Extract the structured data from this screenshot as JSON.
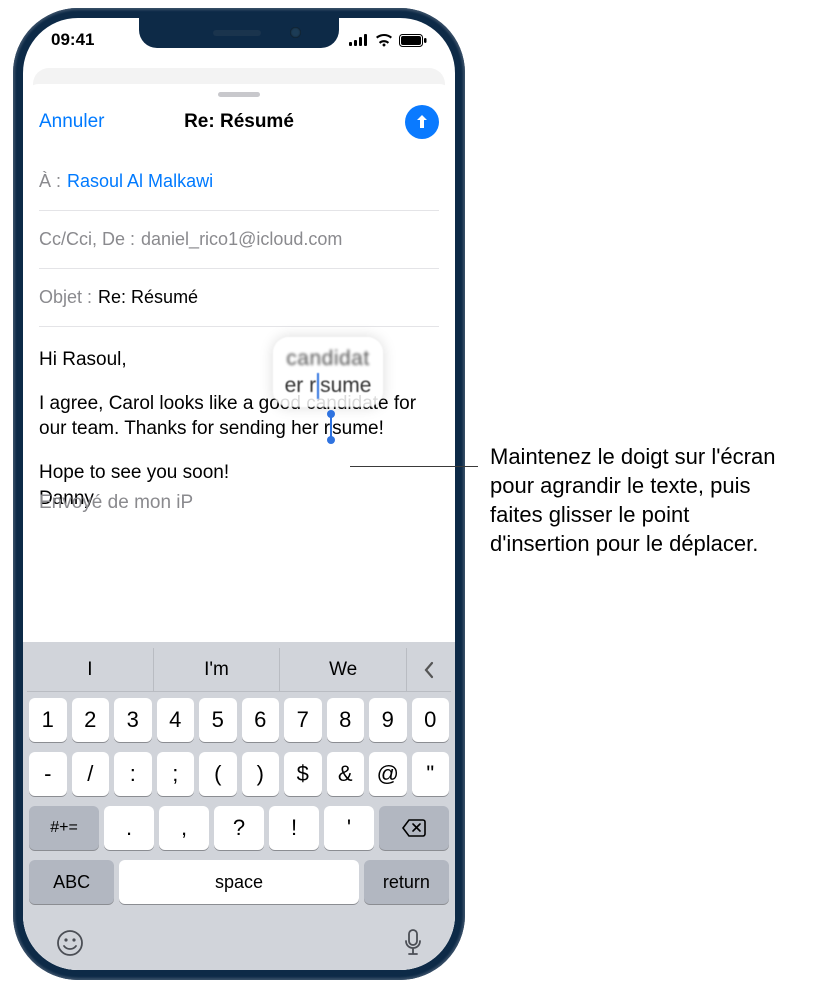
{
  "statusbar": {
    "time": "09:41"
  },
  "nav": {
    "cancel": "Annuler",
    "title": "Re: Résumé"
  },
  "fields": {
    "to_label": "À :",
    "to_value": "Rasoul Al Malkawi",
    "cc_label": "Cc/Cci, De :",
    "cc_value": "daniel_rico1@icloud.com",
    "subject_label": "Objet :",
    "subject_value": "Re: Résumé"
  },
  "body": {
    "greeting": "Hi Rasoul,",
    "p1a": "I agree, Carol looks like a good candidate for our team. Thanks for sending her r",
    "p1b": "sume!",
    "p2": "Hope to see you soon!",
    "sign": "Danny",
    "cut": "Envoyé de mon iP",
    "mag1": "candidat",
    "mag2a": "er r",
    "mag2b": "sume"
  },
  "suggestions": [
    "I",
    "I'm",
    "We"
  ],
  "keys": {
    "row1": [
      "1",
      "2",
      "3",
      "4",
      "5",
      "6",
      "7",
      "8",
      "9",
      "0"
    ],
    "row2": [
      "-",
      "/",
      ":",
      ";",
      "(",
      ")",
      "$",
      "&",
      "@",
      "\""
    ],
    "sym": "#+=",
    "row3": [
      ".",
      ",",
      "?",
      "!",
      "'"
    ],
    "abc": "ABC",
    "space": "space",
    "ret": "return"
  },
  "callout": "Maintenez le doigt sur l'écran pour agrandir le texte, puis faites glisser le point d'insertion pour le déplacer."
}
